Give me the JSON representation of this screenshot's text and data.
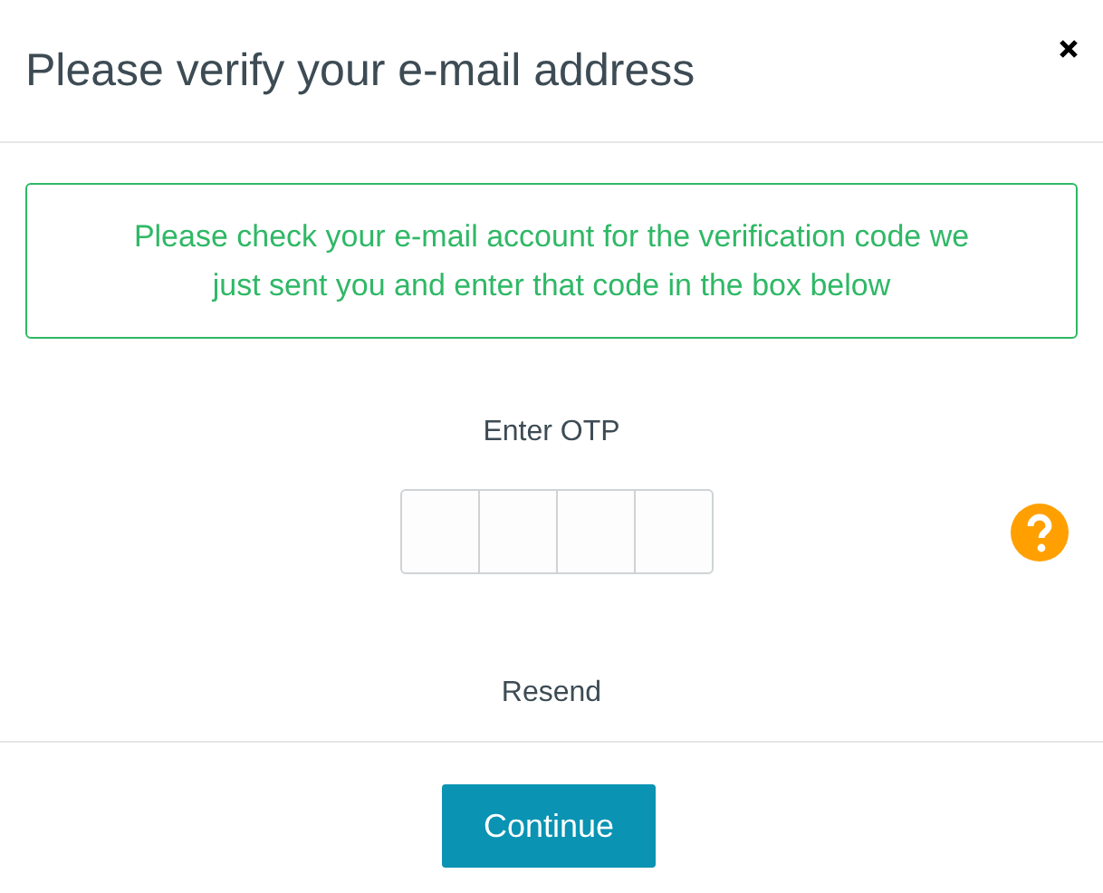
{
  "dialog": {
    "title": "Please verify your e-mail address"
  },
  "notice": {
    "text": "Please check your e-mail account for the verification code we just sent you and enter that code in the box below"
  },
  "otp": {
    "label": "Enter OTP",
    "cells": [
      {
        "kind": "digit"
      },
      {
        "kind": "digit"
      },
      {
        "kind": "digit"
      },
      {
        "kind": "digit"
      }
    ]
  },
  "resend": "Resend",
  "buttons": [
    {
      "label": "Continue",
      "kind": "primary"
    }
  ]
}
